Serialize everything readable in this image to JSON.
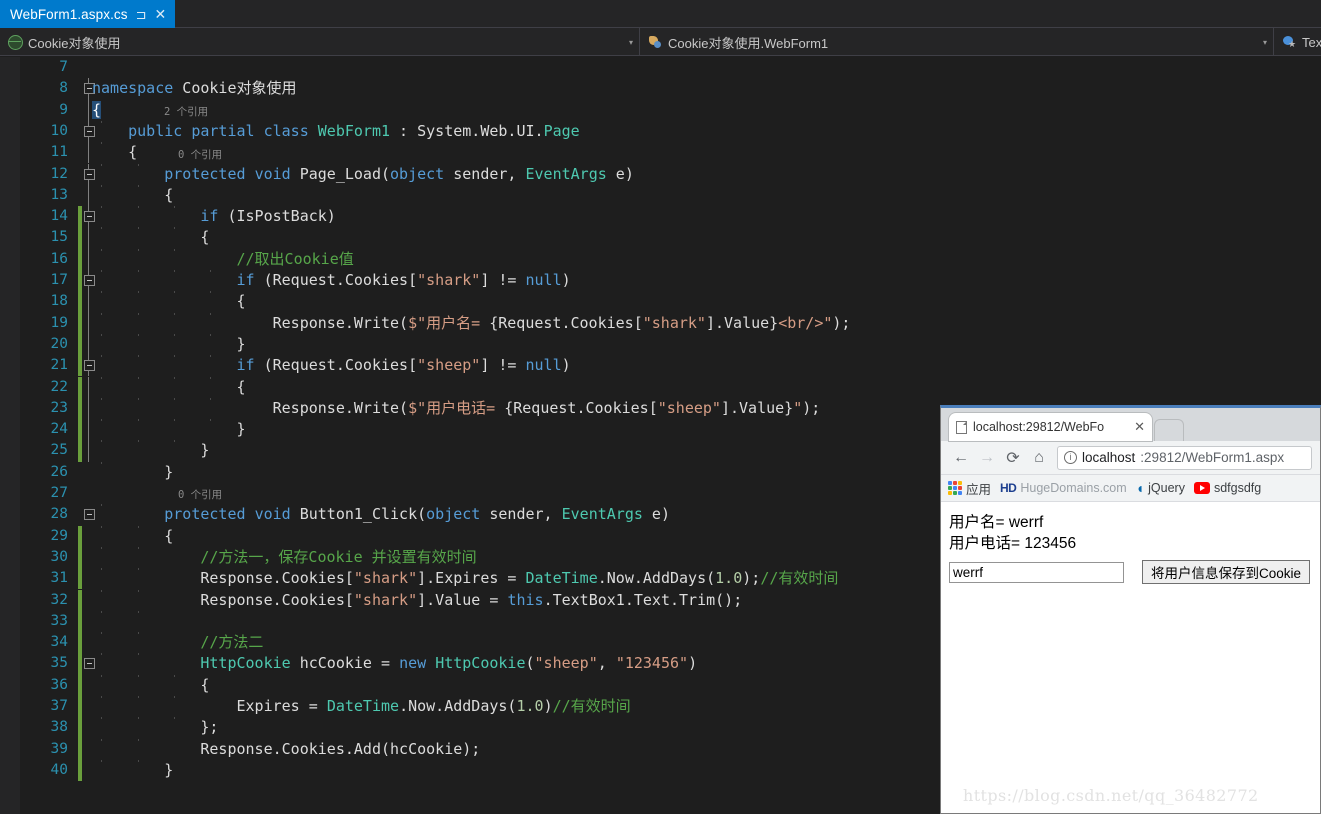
{
  "ide": {
    "tab": {
      "label": "WebForm1.aspx.cs",
      "pin_icon": "⊐",
      "close_icon": "✕"
    },
    "navbar": {
      "project_combo": {
        "icon": "globe-icon",
        "text": "Cookie对象使用",
        "arrow": "▾"
      },
      "type_combo": {
        "icon": "class-icon",
        "text": "Cookie对象使用.WebForm1",
        "arrow": "▾"
      },
      "member_combo": {
        "icon": "property-icon",
        "text": "Text",
        "arrow": "▾"
      }
    },
    "code": {
      "first_line": 7,
      "lines": [
        {
          "n": 7,
          "fold": false,
          "change": false,
          "codelens": null,
          "tokens": []
        },
        {
          "n": 8,
          "fold": true,
          "change": false,
          "codelens": null,
          "tokens": [
            {
              "t": "kw",
              "v": "namespace"
            },
            {
              "t": "plain",
              "v": " Cookie对象使用"
            }
          ]
        },
        {
          "n": 9,
          "fold": false,
          "change": false,
          "codelens": null,
          "tokens": [
            {
              "t": "sel",
              "v": "{"
            }
          ]
        },
        {
          "n": 10,
          "fold": true,
          "change": false,
          "codelens": "2 个引用",
          "tokens": [
            {
              "t": "kw",
              "v": "    public"
            },
            {
              "t": "plain",
              "v": " "
            },
            {
              "t": "kw",
              "v": "partial"
            },
            {
              "t": "plain",
              "v": " "
            },
            {
              "t": "kw",
              "v": "class"
            },
            {
              "t": "plain",
              "v": " "
            },
            {
              "t": "type",
              "v": "WebForm1"
            },
            {
              "t": "plain",
              "v": " : System.Web.UI."
            },
            {
              "t": "type",
              "v": "Page"
            }
          ]
        },
        {
          "n": 11,
          "fold": false,
          "change": false,
          "codelens": null,
          "tokens": [
            {
              "t": "plain",
              "v": "    {"
            }
          ]
        },
        {
          "n": 12,
          "fold": true,
          "change": false,
          "codelens": "0 个引用",
          "tokens": [
            {
              "t": "kw",
              "v": "        protected"
            },
            {
              "t": "plain",
              "v": " "
            },
            {
              "t": "kw",
              "v": "void"
            },
            {
              "t": "plain",
              "v": " Page_Load("
            },
            {
              "t": "kw",
              "v": "object"
            },
            {
              "t": "plain",
              "v": " sender, "
            },
            {
              "t": "type",
              "v": "EventArgs"
            },
            {
              "t": "plain",
              "v": " e)"
            }
          ]
        },
        {
          "n": 13,
          "fold": false,
          "change": false,
          "codelens": null,
          "tokens": [
            {
              "t": "plain",
              "v": "        {"
            }
          ]
        },
        {
          "n": 14,
          "fold": true,
          "change": true,
          "codelens": null,
          "tokens": [
            {
              "t": "kw",
              "v": "            if"
            },
            {
              "t": "plain",
              "v": " (IsPostBack)"
            }
          ]
        },
        {
          "n": 15,
          "fold": false,
          "change": true,
          "codelens": null,
          "tokens": [
            {
              "t": "plain",
              "v": "            {"
            }
          ]
        },
        {
          "n": 16,
          "fold": false,
          "change": true,
          "codelens": null,
          "tokens": [
            {
              "t": "cmt",
              "v": "                //取出Cookie值"
            }
          ]
        },
        {
          "n": 17,
          "fold": true,
          "change": true,
          "codelens": null,
          "tokens": [
            {
              "t": "kw",
              "v": "                if"
            },
            {
              "t": "plain",
              "v": " (Request.Cookies["
            },
            {
              "t": "str",
              "v": "\"shark\""
            },
            {
              "t": "plain",
              "v": "] != "
            },
            {
              "t": "kw",
              "v": "null"
            },
            {
              "t": "plain",
              "v": ")"
            }
          ]
        },
        {
          "n": 18,
          "fold": false,
          "change": true,
          "codelens": null,
          "tokens": [
            {
              "t": "plain",
              "v": "                {"
            }
          ]
        },
        {
          "n": 19,
          "fold": false,
          "change": true,
          "codelens": null,
          "tokens": [
            {
              "t": "plain",
              "v": "                    Response.Write("
            },
            {
              "t": "str",
              "v": "$\"用户名= "
            },
            {
              "t": "plain",
              "v": "{Request.Cookies["
            },
            {
              "t": "str",
              "v": "\"shark\""
            },
            {
              "t": "plain",
              "v": "].Value}"
            },
            {
              "t": "str",
              "v": "<br/>\""
            },
            {
              "t": "plain",
              "v": ");"
            }
          ]
        },
        {
          "n": 20,
          "fold": false,
          "change": true,
          "codelens": null,
          "tokens": [
            {
              "t": "plain",
              "v": "                }"
            }
          ]
        },
        {
          "n": 21,
          "fold": true,
          "change": true,
          "codelens": null,
          "tokens": [
            {
              "t": "kw",
              "v": "                if"
            },
            {
              "t": "plain",
              "v": " (Request.Cookies["
            },
            {
              "t": "str",
              "v": "\"sheep\""
            },
            {
              "t": "plain",
              "v": "] != "
            },
            {
              "t": "kw",
              "v": "null"
            },
            {
              "t": "plain",
              "v": ")"
            }
          ]
        },
        {
          "n": 22,
          "fold": false,
          "change": true,
          "codelens": null,
          "tokens": [
            {
              "t": "plain",
              "v": "                {"
            }
          ]
        },
        {
          "n": 23,
          "fold": false,
          "change": true,
          "codelens": null,
          "tokens": [
            {
              "t": "plain",
              "v": "                    Response.Write("
            },
            {
              "t": "str",
              "v": "$\"用户电话= "
            },
            {
              "t": "plain",
              "v": "{Request.Cookies["
            },
            {
              "t": "str",
              "v": "\"sheep\""
            },
            {
              "t": "plain",
              "v": "].Value}"
            },
            {
              "t": "str",
              "v": "\""
            },
            {
              "t": "plain",
              "v": ");"
            }
          ]
        },
        {
          "n": 24,
          "fold": false,
          "change": true,
          "codelens": null,
          "tokens": [
            {
              "t": "plain",
              "v": "                }"
            }
          ]
        },
        {
          "n": 25,
          "fold": false,
          "change": true,
          "codelens": null,
          "tokens": [
            {
              "t": "plain",
              "v": "            }"
            }
          ]
        },
        {
          "n": 26,
          "fold": false,
          "change": false,
          "codelens": null,
          "tokens": [
            {
              "t": "plain",
              "v": "        }"
            }
          ]
        },
        {
          "n": 27,
          "fold": false,
          "change": false,
          "codelens": null,
          "tokens": []
        },
        {
          "n": 28,
          "fold": true,
          "change": false,
          "codelens": "0 个引用",
          "tokens": [
            {
              "t": "kw",
              "v": "        protected"
            },
            {
              "t": "plain",
              "v": " "
            },
            {
              "t": "kw",
              "v": "void"
            },
            {
              "t": "plain",
              "v": " Button1_Click("
            },
            {
              "t": "kw",
              "v": "object"
            },
            {
              "t": "plain",
              "v": " sender, "
            },
            {
              "t": "type",
              "v": "EventArgs"
            },
            {
              "t": "plain",
              "v": " e)"
            }
          ]
        },
        {
          "n": 29,
          "fold": false,
          "change": true,
          "codelens": null,
          "tokens": [
            {
              "t": "plain",
              "v": "        {"
            }
          ]
        },
        {
          "n": 30,
          "fold": false,
          "change": true,
          "codelens": null,
          "tokens": [
            {
              "t": "cmt",
              "v": "            //方法一，保存Cookie 并设置有效时间"
            }
          ]
        },
        {
          "n": 31,
          "fold": false,
          "change": true,
          "codelens": null,
          "tokens": [
            {
              "t": "plain",
              "v": "            Response.Cookies["
            },
            {
              "t": "str",
              "v": "\"shark\""
            },
            {
              "t": "plain",
              "v": "].Expires = "
            },
            {
              "t": "type",
              "v": "DateTime"
            },
            {
              "t": "plain",
              "v": ".Now.AddDays("
            },
            {
              "t": "num",
              "v": "1.0"
            },
            {
              "t": "plain",
              "v": ");"
            },
            {
              "t": "cmt",
              "v": "//有效时间"
            }
          ]
        },
        {
          "n": 32,
          "fold": false,
          "change": true,
          "codelens": null,
          "tokens": [
            {
              "t": "plain",
              "v": "            Response.Cookies["
            },
            {
              "t": "str",
              "v": "\"shark\""
            },
            {
              "t": "plain",
              "v": "].Value = "
            },
            {
              "t": "kw",
              "v": "this"
            },
            {
              "t": "plain",
              "v": ".TextBox1.Text.Trim();"
            }
          ]
        },
        {
          "n": 33,
          "fold": false,
          "change": true,
          "codelens": null,
          "tokens": []
        },
        {
          "n": 34,
          "fold": false,
          "change": true,
          "codelens": null,
          "tokens": [
            {
              "t": "cmt",
              "v": "            //方法二"
            }
          ]
        },
        {
          "n": 35,
          "fold": true,
          "change": true,
          "codelens": null,
          "tokens": [
            {
              "t": "type",
              "v": "            HttpCookie"
            },
            {
              "t": "plain",
              "v": " hcCookie = "
            },
            {
              "t": "kw",
              "v": "new"
            },
            {
              "t": "plain",
              "v": " "
            },
            {
              "t": "type",
              "v": "HttpCookie"
            },
            {
              "t": "plain",
              "v": "("
            },
            {
              "t": "str",
              "v": "\"sheep\""
            },
            {
              "t": "plain",
              "v": ", "
            },
            {
              "t": "str",
              "v": "\"123456\""
            },
            {
              "t": "plain",
              "v": ")"
            }
          ]
        },
        {
          "n": 36,
          "fold": false,
          "change": true,
          "codelens": null,
          "tokens": [
            {
              "t": "plain",
              "v": "            {"
            }
          ]
        },
        {
          "n": 37,
          "fold": false,
          "change": true,
          "codelens": null,
          "tokens": [
            {
              "t": "plain",
              "v": "                Expires = "
            },
            {
              "t": "type",
              "v": "DateTime"
            },
            {
              "t": "plain",
              "v": ".Now.AddDays("
            },
            {
              "t": "num",
              "v": "1.0"
            },
            {
              "t": "plain",
              "v": ")"
            },
            {
              "t": "cmt",
              "v": "//有效时间"
            }
          ]
        },
        {
          "n": 38,
          "fold": false,
          "change": true,
          "codelens": null,
          "tokens": [
            {
              "t": "plain",
              "v": "            };"
            }
          ]
        },
        {
          "n": 39,
          "fold": false,
          "change": true,
          "codelens": null,
          "tokens": [
            {
              "t": "plain",
              "v": "            Response.Cookies.Add(hcCookie);"
            }
          ]
        },
        {
          "n": 40,
          "fold": false,
          "change": true,
          "codelens": null,
          "tokens": [
            {
              "t": "plain",
              "v": "        }"
            }
          ]
        }
      ]
    }
  },
  "browser": {
    "tab": {
      "title": "localhost:29812/WebFo",
      "close_icon": "✕",
      "favicon": "page-icon"
    },
    "toolbar": {
      "back_icon": "←",
      "forward_icon": "→",
      "reload_icon": "⟳",
      "home_icon": "⌂",
      "url_info_icon": "i",
      "url_host": "localhost",
      "url_path": ":29812/WebForm1.aspx"
    },
    "bookmarks": [
      {
        "icon": "apps-grid-icon",
        "label": "应用"
      },
      {
        "icon": "hd-icon",
        "label": "HugeDomains.com"
      },
      {
        "icon": "jquery-icon",
        "label": "jQuery"
      },
      {
        "icon": "youtube-icon",
        "label": "sdfgsdfg"
      }
    ],
    "page": {
      "line1": "用户名= werrf",
      "line2": "用户电话= 123456",
      "textbox_value": "werrf",
      "textbox_placeholder": "",
      "button_label": "将用户信息保存到Cookie",
      "watermark": "https://blog.csdn.net/qq_36482772"
    }
  },
  "colors": {
    "vs_accent": "#007acc",
    "editor_bg": "#1e1e1e",
    "keyword": "#569cd6",
    "type": "#4ec9b0",
    "string": "#d69d85",
    "comment": "#57a64a",
    "number": "#b5cea8",
    "linenumber": "#2b91af",
    "changebar": "#6a9f3c"
  }
}
